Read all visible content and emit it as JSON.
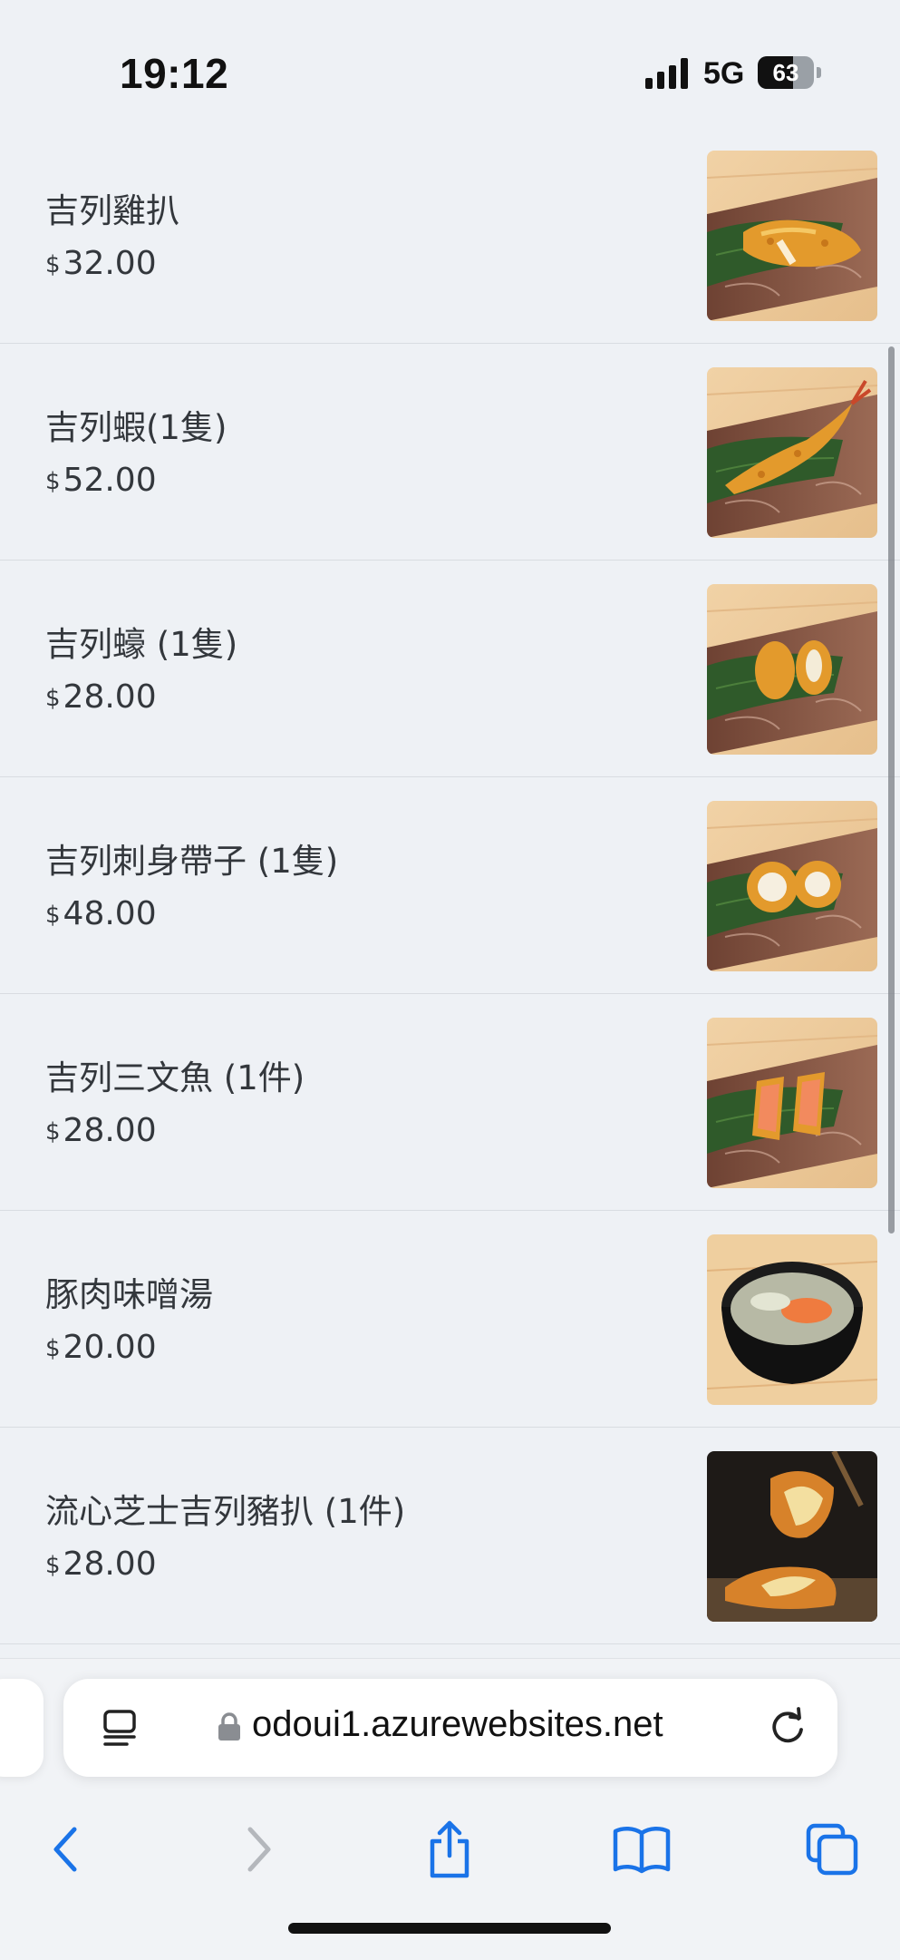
{
  "status_bar": {
    "time": "19:12",
    "network": "5G",
    "battery_level": "63"
  },
  "menu": {
    "items": [
      {
        "name": "吉列雞扒",
        "currency": "$",
        "price": "32.00",
        "photo": "fried-chicken-cutlet"
      },
      {
        "name": "吉列蝦(1隻)",
        "currency": "$",
        "price": "52.00",
        "photo": "fried-prawn"
      },
      {
        "name": "吉列蠔 (1隻)",
        "currency": "$",
        "price": "28.00",
        "photo": "fried-oyster"
      },
      {
        "name": "吉列刺身帶子 (1隻)",
        "currency": "$",
        "price": "48.00",
        "photo": "fried-scallop"
      },
      {
        "name": "吉列三文魚 (1件)",
        "currency": "$",
        "price": "28.00",
        "photo": "fried-salmon"
      },
      {
        "name": "豚肉味噌湯",
        "currency": "$",
        "price": "20.00",
        "photo": "pork-miso-soup"
      },
      {
        "name": "流心芝士吉列豬扒 (1件)",
        "currency": "$",
        "price": "28.00",
        "photo": "cheese-pork-cutlet"
      }
    ]
  },
  "browser": {
    "url": "odoui1.azurewebsites.net",
    "icons": {
      "reader": "reader-mode-icon",
      "lock": "lock-icon",
      "reload": "reload-icon",
      "back": "back-icon",
      "forward": "forward-icon",
      "share": "share-icon",
      "bookmarks": "bookmarks-icon",
      "tabs": "tabs-icon"
    },
    "accent_color": "#1a73e8"
  }
}
